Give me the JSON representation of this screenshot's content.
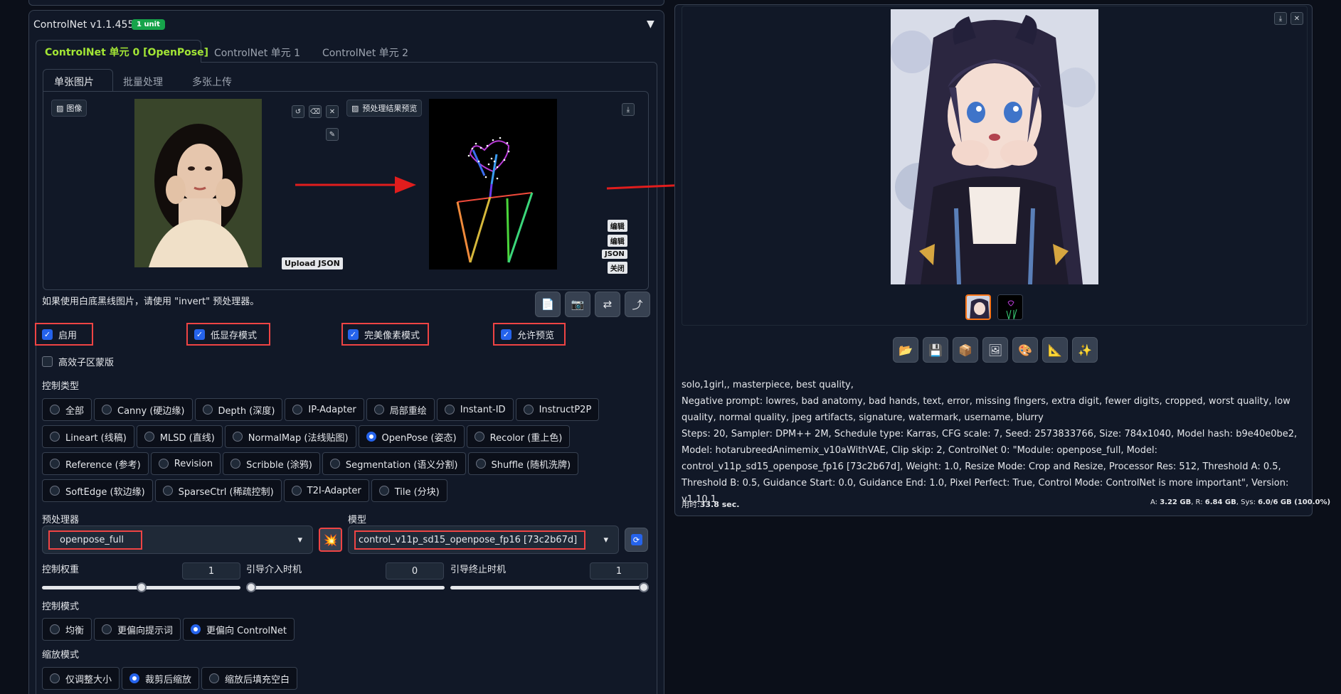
{
  "controlnet": {
    "title": "ControlNet v1.1.455",
    "badge": "1 unit",
    "collapse_icon": "▼",
    "unit_tabs": [
      "ControlNet 单元 0 [OpenPose]",
      "ControlNet 单元 1",
      "ControlNet 单元 2"
    ],
    "input_tabs": [
      "单张图片",
      "批量处理",
      "多张上传"
    ],
    "image_label": "图像",
    "preview_label": "预处理结果预览",
    "upload_json": "Upload JSON",
    "edit_buttons": [
      "编辑",
      "编辑",
      "JSON",
      "关闭"
    ],
    "hint": "如果使用白底黑线图片，请使用 \"invert\" 预处理器。",
    "checkboxes": [
      {
        "label": "启用",
        "checked": true
      },
      {
        "label": "低显存模式",
        "checked": true
      },
      {
        "label": "完美像素模式",
        "checked": true
      },
      {
        "label": "允许预览",
        "checked": true
      }
    ],
    "mask_checkbox": {
      "label": "高效子区蒙版",
      "checked": false
    },
    "control_type_label": "控制类型",
    "control_types_row1": [
      "全部",
      "Canny (硬边缘)",
      "Depth (深度)",
      "IP-Adapter",
      "局部重绘",
      "Instant-ID",
      "InstructP2P"
    ],
    "control_types_row2": [
      "Lineart (线稿)",
      "MLSD (直线)",
      "NormalMap (法线贴图)",
      "OpenPose (姿态)",
      "Recolor (重上色)"
    ],
    "control_types_row3": [
      "Reference (参考)",
      "Revision",
      "Scribble (涂鸦)",
      "Segmentation (语义分割)",
      "Shuffle (随机洗牌)"
    ],
    "control_types_row4": [
      "SoftEdge (软边缘)",
      "SparseCtrl (稀疏控制)",
      "T2I-Adapter",
      "Tile (分块)"
    ],
    "selected_control_type": "OpenPose (姿态)",
    "preprocessor_label": "预处理器",
    "preprocessor_value": "openpose_full",
    "model_label": "模型",
    "model_value": "control_v11p_sd15_openpose_fp16 [73c2b67d]",
    "weight_label": "控制权重",
    "weight_value": "1",
    "weight_fraction": 0.5,
    "start_label": "引导介入时机",
    "start_value": "0",
    "start_fraction": 0.0,
    "end_label": "引导终止时机",
    "end_value": "1",
    "end_fraction": 1.0,
    "control_mode_label": "控制模式",
    "control_modes": [
      "均衡",
      "更偏向提示词",
      "更偏向 ControlNet"
    ],
    "selected_control_mode": "更偏向 ControlNet",
    "resize_mode_label": "缩放模式",
    "resize_modes": [
      "仅调整大小",
      "裁剪后缩放",
      "缩放后填充空白"
    ],
    "selected_resize_mode": "裁剪后缩放"
  },
  "output": {
    "info_prompt": "solo,1girl,, masterpiece, best quality,",
    "info_negative": "Negative prompt: lowres, bad anatomy, bad hands, text, error, missing fingers, extra digit, fewer digits, cropped, worst quality, low quality, normal quality, jpeg artifacts, signature, watermark, username, blurry",
    "info_params": "Steps: 20, Sampler: DPM++ 2M, Schedule type: Karras, CFG scale: 7, Seed: 2573833766, Size: 784x1040, Model hash: b9e40e0be2, Model: hotarubreedAnimemix_v10aWithVAE, Clip skip: 2, ControlNet 0: \"Module: openpose_full, Model: control_v11p_sd15_openpose_fp16 [73c2b67d], Weight: 1.0, Resize Mode: Crop and Resize, Processor Res: 512, Threshold A: 0.5, Threshold B: 0.5, Guidance Start: 0.0, Guidance End: 1.0, Pixel Perfect: True, Control Mode: ControlNet is more important\", Version: v1.10.1",
    "time_label": "用时:",
    "time_value": "33.8 sec.",
    "mem_a_label": "A: ",
    "mem_a": "3.22 GB",
    "mem_r_label": ", R: ",
    "mem_r": "6.84 GB",
    "mem_s_label": ", Sys: ",
    "mem_s": "6.0/6 GB (100.0%)"
  },
  "colors": {
    "accent": "#2563eb",
    "highlight": "#ef4444",
    "active_tab": "#a3e635",
    "badge": "#16a34a"
  },
  "icons": {
    "toolbar": [
      "document-icon",
      "camera-icon",
      "swap-icon",
      "send-icon"
    ],
    "actions": [
      "folder-icon",
      "save-icon",
      "zip-icon",
      "image-icon",
      "palette-icon",
      "ruler-icon",
      "sparkle-icon"
    ]
  }
}
